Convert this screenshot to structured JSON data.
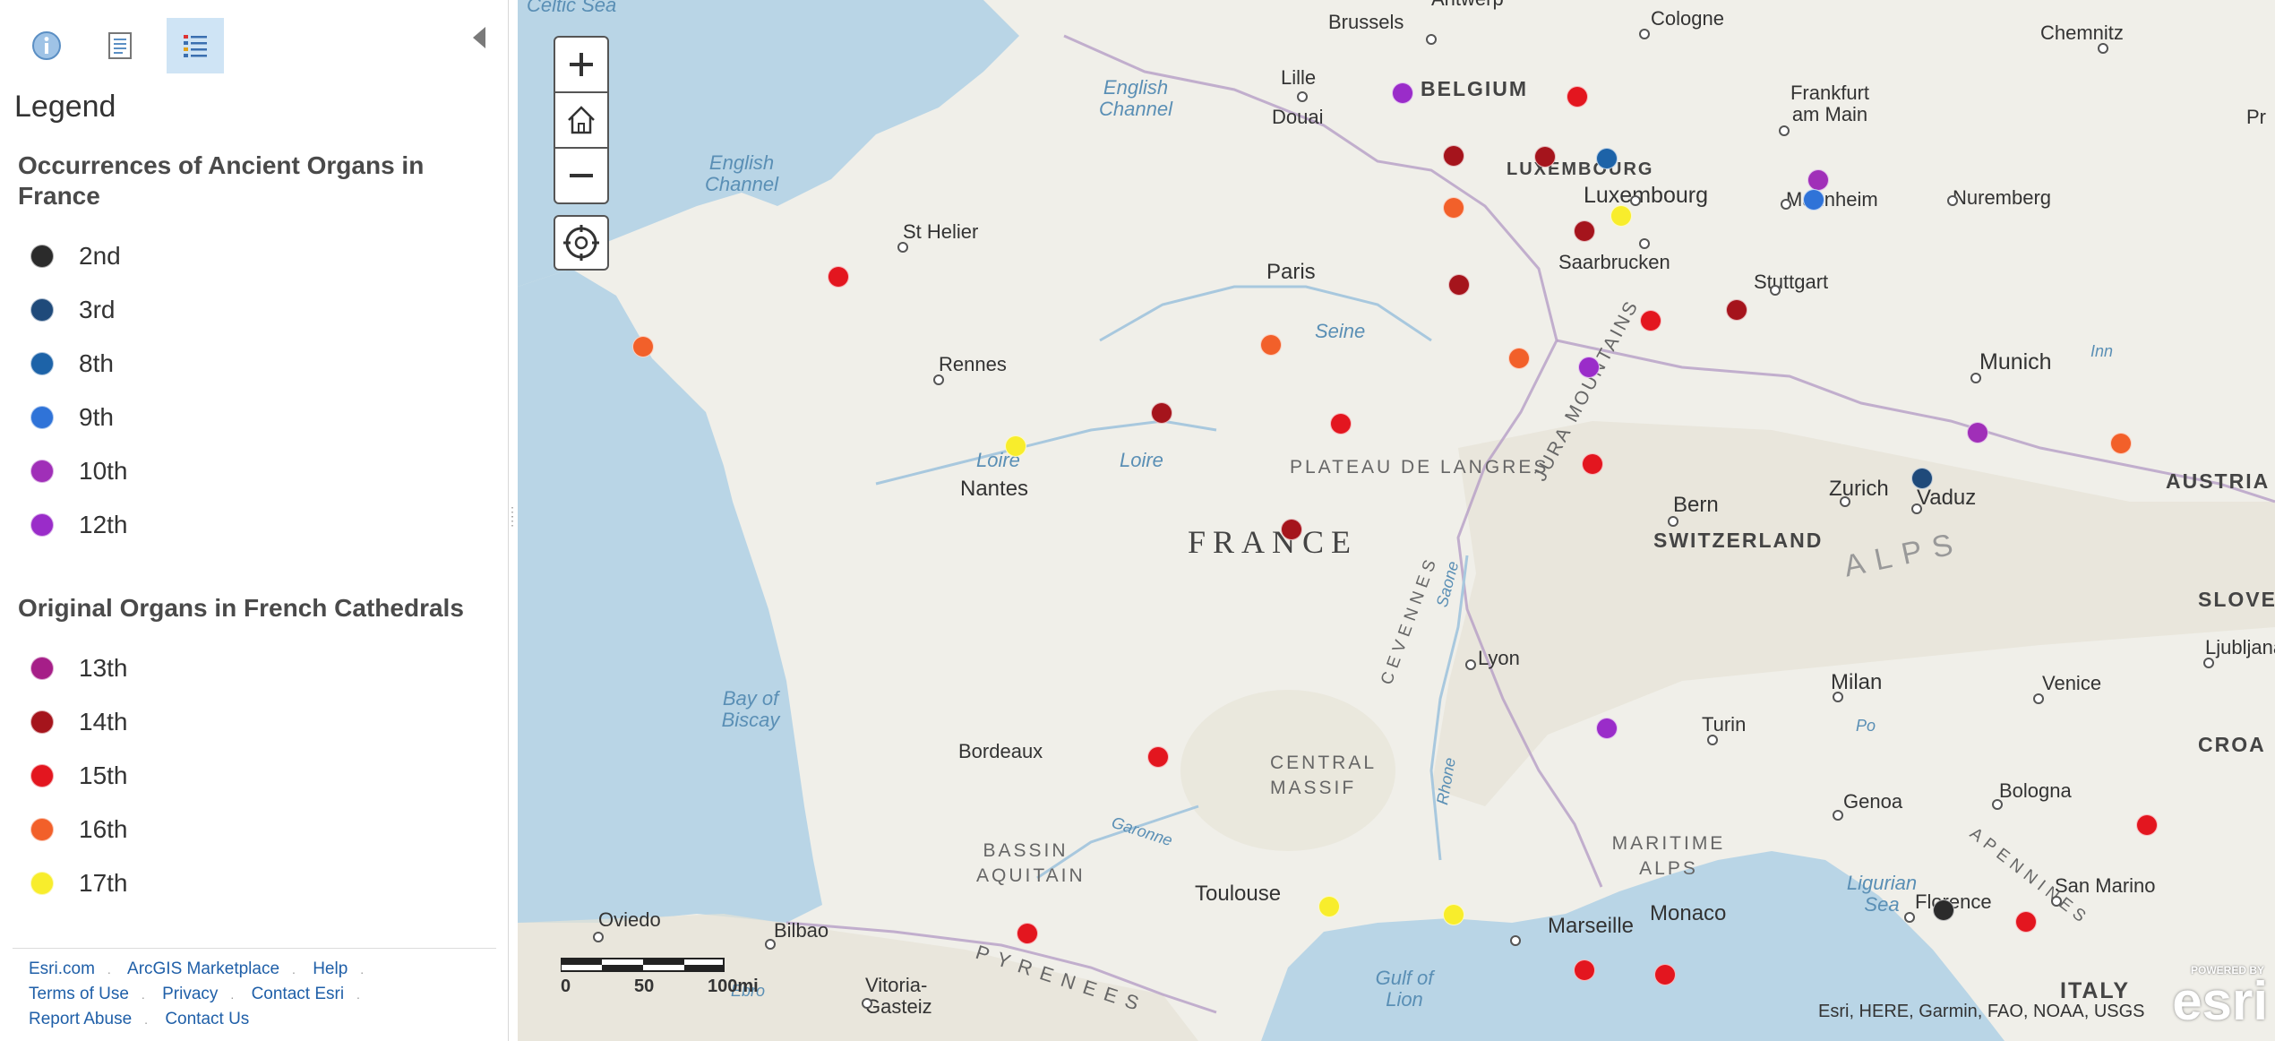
{
  "sidebar": {
    "tools": [
      {
        "name": "info-button",
        "icon": "info-icon"
      },
      {
        "name": "content-button",
        "icon": "content-icon"
      },
      {
        "name": "legend-button",
        "icon": "legend-list-icon"
      }
    ],
    "legend_title": "Legend",
    "layers": [
      {
        "title": "Occurrences of Ancient Organs in France",
        "items": [
          {
            "label": "2nd",
            "color": "#2b2b2b"
          },
          {
            "label": "3rd",
            "color": "#1f4a7a"
          },
          {
            "label": "8th",
            "color": "#1d63a8"
          },
          {
            "label": "9th",
            "color": "#2f73d8"
          },
          {
            "label": "10th",
            "color": "#a02fb8"
          },
          {
            "label": "12th",
            "color": "#9a2cc9"
          }
        ]
      },
      {
        "title": "Original Organs in French Cathedrals",
        "items": [
          {
            "label": "13th",
            "color": "#a61e88"
          },
          {
            "label": "14th",
            "color": "#a5141c"
          },
          {
            "label": "15th",
            "color": "#e3161f"
          },
          {
            "label": "16th",
            "color": "#f2602a"
          },
          {
            "label": "17th",
            "color": "#f8ed2c"
          }
        ]
      }
    ],
    "footer": {
      "row1": [
        "Esri.com",
        "ArcGIS Marketplace",
        "Help"
      ],
      "row2": [
        "Terms of Use",
        "Privacy",
        "Contact Esri"
      ],
      "row3": [
        "Report Abuse",
        "Contact Us"
      ]
    }
  },
  "map": {
    "controls": {
      "zoom_in": "+",
      "home": "home-icon",
      "zoom_out": "−",
      "locate": "locate-icon"
    },
    "places": {
      "celtic_sea": "Celtic Sea",
      "english_channel_1": "English Channel",
      "english_channel_2": "English Channel",
      "brussels": "Brussels",
      "antwerp": "Antwerp",
      "cologne": "Cologne",
      "chemnitz": "Chemnitz",
      "lille": "Lille",
      "douai": "Douai",
      "belgium": "BELGIUM",
      "frankfurt": "Frankfurt am Main",
      "luxembourg_cap": "LUXEMBOURG",
      "luxembourg": "Luxembourg",
      "mannheim": "Mannheim",
      "nuremberg": "Nuremberg",
      "st_helier": "St Helier",
      "paris": "Paris",
      "saarbrucken": "Saarbrucken",
      "stuttgart": "Stuttgart",
      "rennes": "Rennes",
      "seine": "Seine",
      "munich": "Munich",
      "inn": "Inn",
      "loire_1": "Loire",
      "loire_2": "Loire",
      "nantes": "Nantes",
      "plateau": "PLATEAU DE LANGRES",
      "zurich": "Zurich",
      "vaduz": "Vaduz",
      "bern": "Bern",
      "austria": "AUSTRIA",
      "switzerland": "SWITZERLAND",
      "france": "FRANCE",
      "jura": "JURA MOUNTAINS",
      "alps": "ALPS",
      "slovenia": "SLOVE",
      "ljubljana": "Ljubljana",
      "bay_of_biscay": "Bay of Biscay",
      "lyon": "Lyon",
      "saone": "Saone",
      "milan": "Milan",
      "venice": "Venice",
      "turin": "Turin",
      "croatia": "CROA",
      "po": "Po",
      "bordeaux": "Bordeaux",
      "central_massif": "CENTRAL MASSIF",
      "cevennes": "CEVENNES",
      "rhone": "Rhone",
      "genoa": "Genoa",
      "bologna": "Bologna",
      "garonne": "Garonne",
      "maritime_alps": "MARITIME ALPS",
      "bassin": "BASSIN AQUITAIN",
      "toulouse": "Toulouse",
      "ligurian_sea": "Ligurian Sea",
      "florence": "Florence",
      "san_marino": "San Marino",
      "apennines": "APENNINES",
      "oviedo": "Oviedo",
      "bilbao": "Bilbao",
      "marseille": "Marseille",
      "monaco": "Monaco",
      "pyrenees": "PYRENEES",
      "ebro": "Ebro",
      "vitoria": "Vitoria-Gasteiz",
      "gulf_of_lion": "Gulf of Lion",
      "italy": "ITALY",
      "pr": "Pr"
    },
    "scale": {
      "zero": "0",
      "mid": "50",
      "end": "100mi"
    },
    "attribution": "Esri, HERE, Garmin, FAO, NOAA, USGS",
    "logo": {
      "powered_by": "POWERED BY",
      "name": "esri"
    },
    "colors": {
      "c2": "#2b2b2b",
      "c3": "#1f4a7a",
      "c8": "#1d63a8",
      "c9": "#2f73d8",
      "c10": "#a02fb8",
      "c12": "#9a2cc9",
      "c13": "#a61e88",
      "c14": "#a5141c",
      "c15": "#e3161f",
      "c16": "#f2602a",
      "c17": "#f8ed2c"
    },
    "markers": [
      {
        "category": "12th",
        "lon": 1.1,
        "lat": 49.92
      },
      {
        "category": "15th",
        "lon": 2.3,
        "lat": 49.89
      },
      {
        "category": "14th",
        "lon": 1.45,
        "lat": 49.44
      },
      {
        "category": "14th",
        "lon": 2.08,
        "lat": 49.43
      },
      {
        "category": "8th",
        "lon": 2.5,
        "lat": 49.42
      },
      {
        "category": "10th",
        "lon": 3.95,
        "lat": 49.25
      },
      {
        "category": "9th",
        "lon": 3.92,
        "lat": 49.1
      },
      {
        "category": "16th",
        "lon": 1.45,
        "lat": 49.04
      },
      {
        "category": "17th",
        "lon": 2.6,
        "lat": 48.98
      },
      {
        "category": "14th",
        "lon": 2.35,
        "lat": 48.86
      },
      {
        "category": "15th",
        "lon": -2.76,
        "lat": 48.51
      },
      {
        "category": "13th",
        "lon": 7.35,
        "lat": 48.08
      },
      {
        "category": "14th",
        "lon": 1.49,
        "lat": 48.45
      },
      {
        "category": "14th",
        "lon": 3.39,
        "lat": 48.26
      },
      {
        "category": "15th",
        "lon": 2.8,
        "lat": 48.18
      },
      {
        "category": "16th",
        "lon": -4.1,
        "lat": 47.98
      },
      {
        "category": "16th",
        "lon": 0.2,
        "lat": 47.99
      },
      {
        "category": "16th",
        "lon": 1.9,
        "lat": 47.89
      },
      {
        "category": "12th",
        "lon": 2.38,
        "lat": 47.82
      },
      {
        "category": "14th",
        "lon": -0.55,
        "lat": 47.47
      },
      {
        "category": "15th",
        "lon": 0.68,
        "lat": 47.39
      },
      {
        "category": "10th",
        "lon": 5.04,
        "lat": 47.32
      },
      {
        "category": "16th",
        "lon": 6.02,
        "lat": 47.24
      },
      {
        "category": "15th",
        "lon": 2.4,
        "lat": 47.08
      },
      {
        "category": "3rd",
        "lon": 4.66,
        "lat": 46.97
      },
      {
        "category": "17th",
        "lon": -1.55,
        "lat": 47.22
      },
      {
        "category": "14th",
        "lon": 0.34,
        "lat": 46.58
      },
      {
        "category": "12th",
        "lon": 2.5,
        "lat": 45.06
      },
      {
        "category": "15th",
        "lon": -0.57,
        "lat": 44.84
      },
      {
        "category": "15th",
        "lon": 6.2,
        "lat": 44.32
      },
      {
        "category": "17th",
        "lon": 0.6,
        "lat": 43.7
      },
      {
        "category": "17th",
        "lon": 1.45,
        "lat": 43.64
      },
      {
        "category": "15th",
        "lon": -1.47,
        "lat": 43.49
      },
      {
        "category": "15th",
        "lon": 2.35,
        "lat": 43.21
      },
      {
        "category": "15th",
        "lon": 2.9,
        "lat": 43.18
      },
      {
        "category": "2nd",
        "lon": 4.81,
        "lat": 43.67
      },
      {
        "category": "15th",
        "lon": 5.37,
        "lat": 43.58
      },
      {
        "category": "17th",
        "lon": 7.27,
        "lat": 43.71
      }
    ]
  }
}
